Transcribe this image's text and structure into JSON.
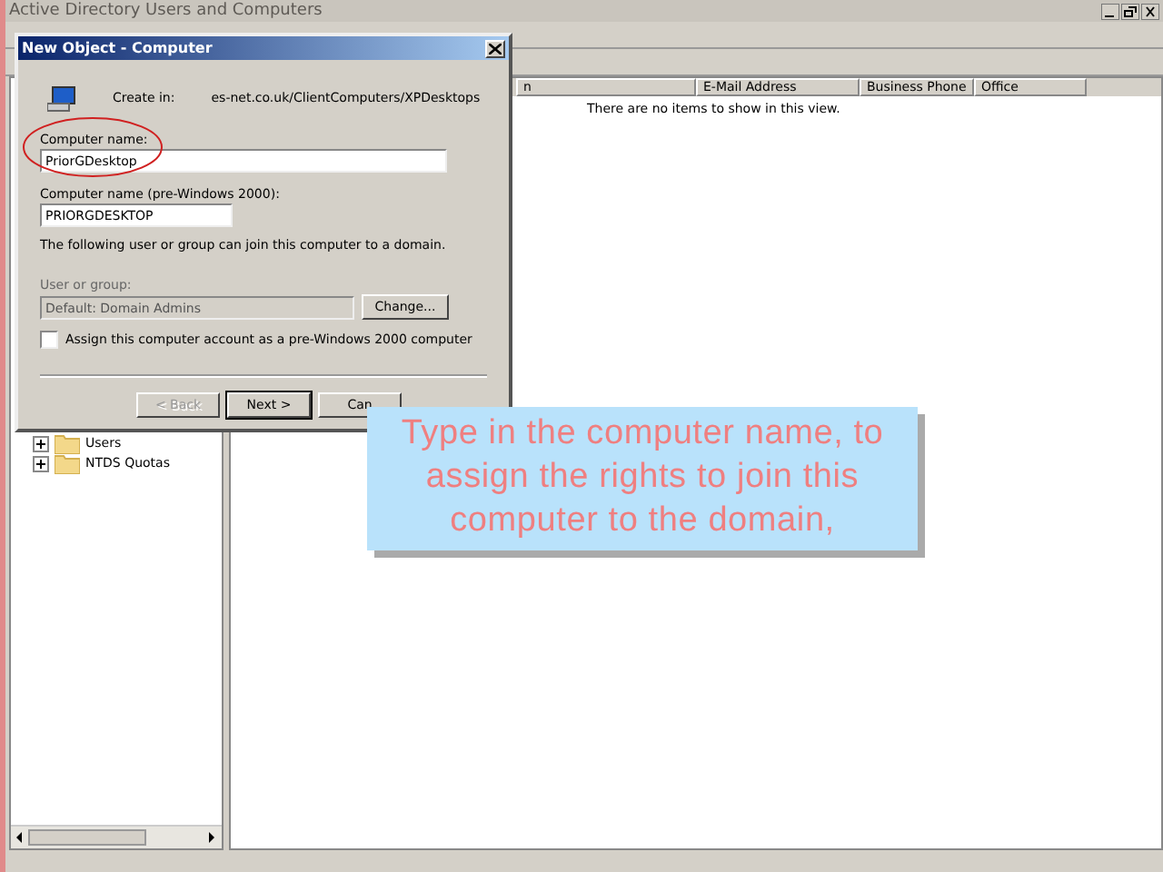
{
  "main_window": {
    "title": "Active Directory Users and Computers"
  },
  "tree": {
    "items": [
      {
        "label": "Users",
        "expanded": false
      },
      {
        "label": "NTDS Quotas",
        "expanded": false
      }
    ]
  },
  "list": {
    "columns": [
      "n",
      "E-Mail Address",
      "Business Phone",
      "Office"
    ],
    "empty_message": "There are no items to show in this view."
  },
  "dialog": {
    "title": "New Object - Computer",
    "create_in_label": "Create in:",
    "create_in_path": "es-net.co.uk/ClientComputers/XPDesktops",
    "computer_name_label": "Computer name:",
    "computer_name_value": "PriorGDesktop",
    "pre2000_label": "Computer name (pre-Windows 2000):",
    "pre2000_value": "PRIORGDESKTOP",
    "join_note": "The following user or group can join this computer to a domain.",
    "user_group_label": "User or group:",
    "user_group_value": "Default: Domain Admins",
    "change_button": "Change...",
    "checkbox": {
      "label": "Assign this computer account as a pre-Windows 2000 computer",
      "checked": false
    },
    "buttons": [
      {
        "label": "< Back",
        "disabled": true,
        "default": false
      },
      {
        "label": "Next >",
        "disabled": false,
        "default": true
      },
      {
        "label": "Can",
        "disabled": false,
        "default": false
      }
    ]
  },
  "callout": {
    "text": "Type in the computer name, to assign the rights to join this computer to the domain,"
  }
}
